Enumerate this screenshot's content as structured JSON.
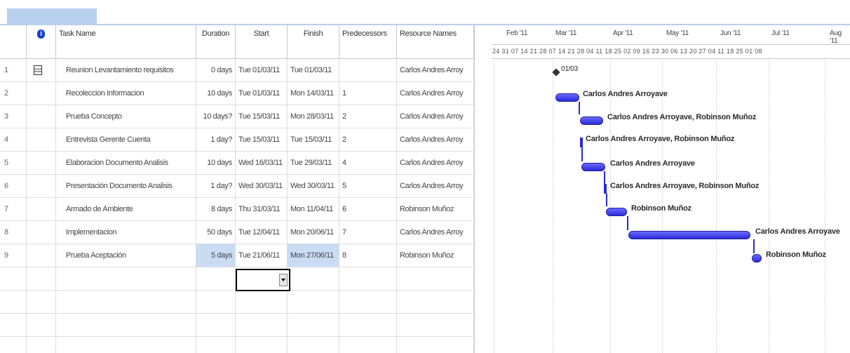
{
  "headers": {
    "info": "i",
    "task": "Task Name",
    "duration": "Duration",
    "start": "Start",
    "finish": "Finish",
    "predecessors": "Predecessors",
    "resources": "Resource Names"
  },
  "rows": [
    {
      "num": "1",
      "name": "Reunion Levantamiento requisitos",
      "duration": "0 days",
      "start": "Tue 01/03/11",
      "finish": "Tue 01/03/11",
      "pred": "",
      "res": "Carlos Andres Arroy"
    },
    {
      "num": "2",
      "name": "Recoleccion Informacion",
      "duration": "10 days",
      "start": "Tue 01/03/11",
      "finish": "Mon 14/03/11",
      "pred": "1",
      "res": "Carlos Andres Arroy"
    },
    {
      "num": "3",
      "name": "Prueba Concepto",
      "duration": "10 days?",
      "start": "Tue 15/03/11",
      "finish": "Mon 28/03/11",
      "pred": "2",
      "res": "Carlos Andres Arroy"
    },
    {
      "num": "4",
      "name": "Entrevista Gerente Cuenta",
      "duration": "1 day?",
      "start": "Tue 15/03/11",
      "finish": "Tue 15/03/11",
      "pred": "2",
      "res": "Carlos Andres Arroy"
    },
    {
      "num": "5",
      "name": "Elaboracion Documento Analisis",
      "duration": "10 days",
      "start": "Wed 16/03/11",
      "finish": "Tue 29/03/11",
      "pred": "4",
      "res": "Carlos Andres Arroy"
    },
    {
      "num": "6",
      "name": "Presentación Documento Analisis",
      "duration": "1 day?",
      "start": "Wed 30/03/11",
      "finish": "Wed 30/03/11",
      "pred": "5",
      "res": "Carlos Andres Arroy"
    },
    {
      "num": "7",
      "name": "Armado de Ambiente",
      "duration": "8 days",
      "start": "Thu 31/03/11",
      "finish": "Mon 11/04/11",
      "pred": "6",
      "res": "Robinson Muñoz"
    },
    {
      "num": "8",
      "name": "Implementacion",
      "duration": "50 days",
      "start": "Tue 12/04/11",
      "finish": "Mon 20/06/11",
      "pred": "7",
      "res": "Carlos Andres Arroy"
    },
    {
      "num": "9",
      "name": "Prueba Aceptación",
      "duration": "5 days",
      "start": "Tue 21/06/11",
      "finish": "Mon 27/06/11",
      "pred": "8",
      "res": "Robinson Muñoz"
    }
  ],
  "timeline": {
    "months": [
      "Feb '11",
      "Mar '11",
      "Apr '11",
      "May '11",
      "Jun '11",
      "Jul '11",
      "Aug '11"
    ],
    "days": "24 31 07 14 21 28 07 14 21 28 04 11 18 25 02 09 16 23 30 06 13 20 27 04 11 18 25 01 08"
  },
  "gantt_labels": {
    "milestone": "01/03",
    "r2": "Carlos Andres Arroyave",
    "r3": "Carlos Andres Arroyave, Robinson Muñoz",
    "r4": "Carlos Andres Arroyave, Robinson Muñoz",
    "r5": "Carlos Andres Arroyave",
    "r6": "Carlos Andres Arroyave, Robinson Muñoz",
    "r7": "Robinson Muñoz",
    "r8": "Carlos Andres Arroyave",
    "r9": "Robinson Muñoz"
  },
  "colors": {
    "bar": "#2a2ad8",
    "selected": "#c9dcf4",
    "info_icon": "#1a3fd0"
  }
}
